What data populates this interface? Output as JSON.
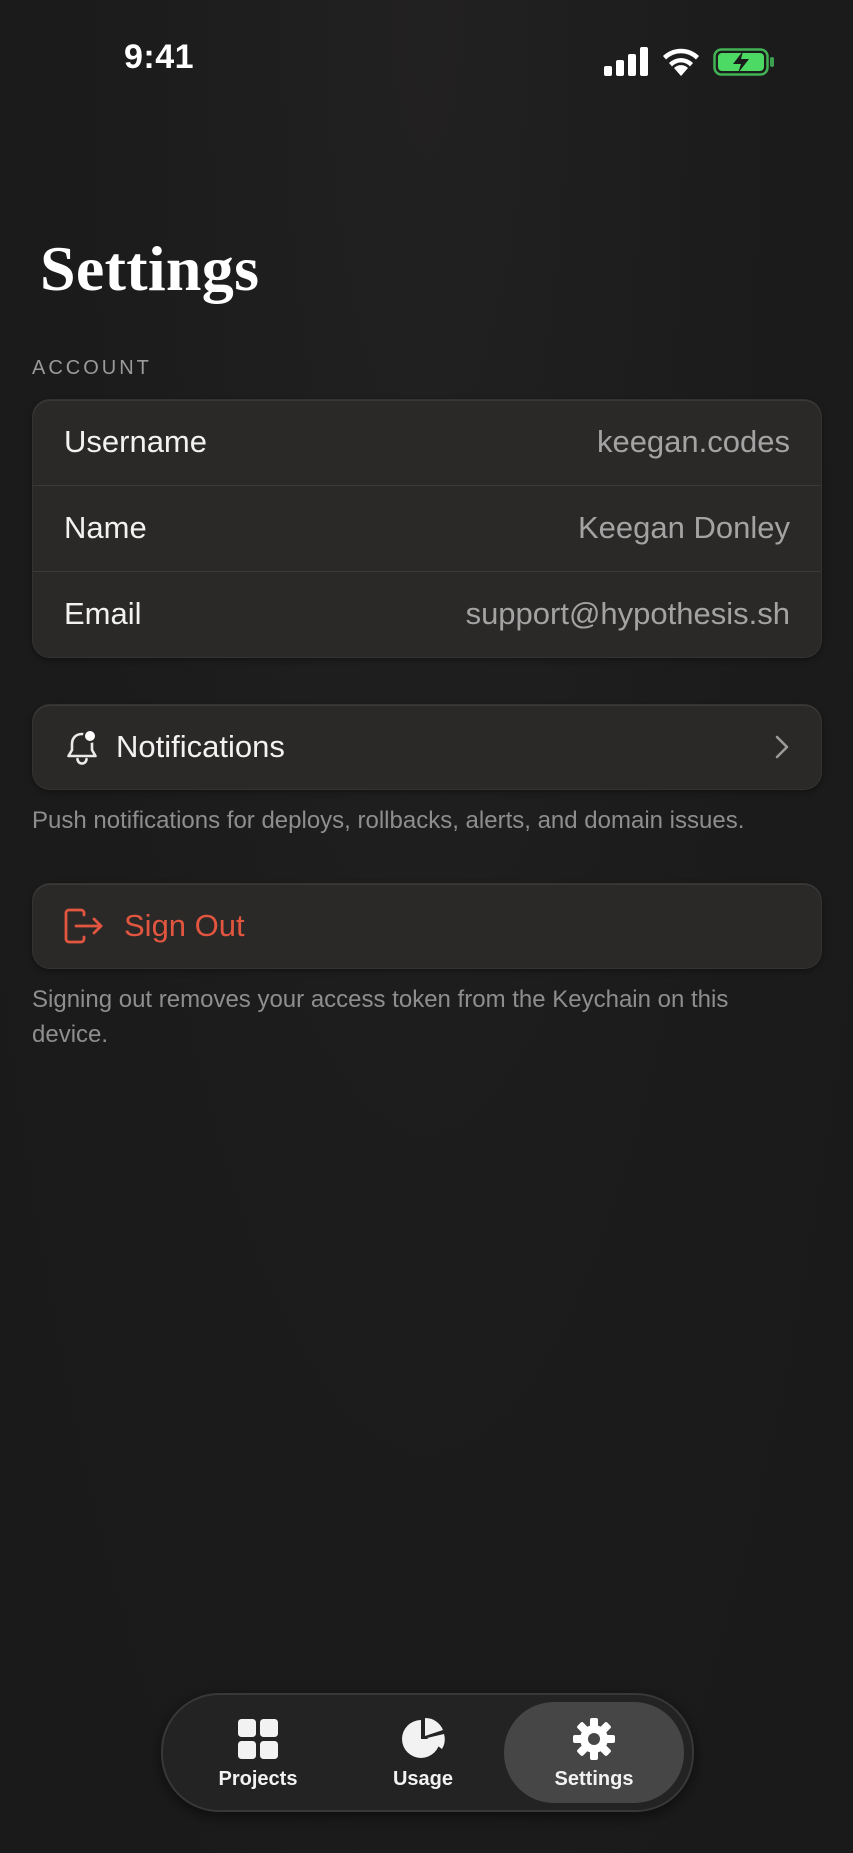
{
  "status_bar": {
    "time": "9:41",
    "signal_icon": "cellular-signal-icon",
    "wifi_icon": "wifi-icon",
    "battery_icon": "battery-charging-icon",
    "battery_color": "#4cd964"
  },
  "page": {
    "title": "Settings"
  },
  "account": {
    "header": "ACCOUNT",
    "rows": [
      {
        "label": "Username",
        "value": "keegan.codes"
      },
      {
        "label": "Name",
        "value": "Keegan Donley"
      },
      {
        "label": "Email",
        "value": "support@hypothesis.sh"
      }
    ]
  },
  "notifications": {
    "icon": "bell-icon",
    "label": "Notifications",
    "chevron": "chevron-right-icon",
    "footnote": "Push notifications for deploys, rollbacks, alerts, and domain issues."
  },
  "sign_out": {
    "icon": "sign-out-icon",
    "label": "Sign Out",
    "color": "#e2553f",
    "footnote": "Signing out removes your access token from the Keychain on this device."
  },
  "tab_bar": {
    "tabs": [
      {
        "label": "Projects",
        "icon": "grid-icon",
        "selected": false
      },
      {
        "label": "Usage",
        "icon": "pie-chart-icon",
        "selected": false
      },
      {
        "label": "Settings",
        "icon": "gear-icon",
        "selected": true
      }
    ]
  }
}
